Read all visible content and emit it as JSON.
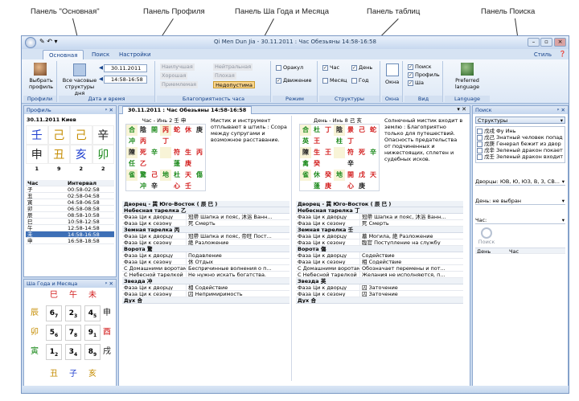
{
  "annotations": [
    "Панель \"Основная\"",
    "Панель Профиля",
    "Панель Ша Года и Месяца",
    "Панель таблиц",
    "Панель Поиска"
  ],
  "window": {
    "title": "Qi Men Dun Jia - 30.11.2011 : Час Обезьяны 14:58-16:58"
  },
  "tabs": [
    "Основная",
    "Поиск",
    "Настройки"
  ],
  "style_label": "Стиль",
  "ribbon": {
    "profiles": {
      "btn": "Выбрать профиль",
      "label": "Профили"
    },
    "datetime": {
      "all_hours": "Все часовые структуры дня",
      "date": "30.11.2011",
      "time": "14:58-16:58",
      "label": "Дата и время"
    },
    "favor": {
      "chips": [
        "Наилучшая",
        "Хорошая",
        "Приемлемая",
        "Нейтральная",
        "Плохая",
        "Недопустима"
      ],
      "label": "Благоприятность часа"
    },
    "mode": {
      "items": [
        "Оракул",
        "Движение"
      ],
      "label": "Режим"
    },
    "structures": {
      "items": [
        "Час",
        "Месяц",
        "День",
        "Год"
      ],
      "label": "Структуры"
    },
    "windows": {
      "btn": "Окна",
      "label": "Окна"
    },
    "view": {
      "items": [
        "Поиск",
        "Профиль",
        "Ша"
      ],
      "label": "Вид"
    },
    "language": {
      "btn": "Preferred language",
      "label": "Language"
    }
  },
  "profile": {
    "title": "Профиль",
    "date_city": "30.11.2011 Киев",
    "pillars_top": [
      "壬",
      "己",
      "己",
      "辛"
    ],
    "pillars_bottom": [
      "申",
      "丑",
      "亥",
      "卯"
    ],
    "numbers": [
      "1",
      "9",
      "2",
      "2"
    ],
    "cols": [
      "Час",
      "Интервал"
    ],
    "rows": [
      [
        "子",
        "00:58-02:58"
      ],
      [
        "丑",
        "02:58-04:58"
      ],
      [
        "寅",
        "04:58-06:58"
      ],
      [
        "卯",
        "06:58-08:58"
      ],
      [
        "辰",
        "08:58-10:58"
      ],
      [
        "巳",
        "10:58-12:58"
      ],
      [
        "午",
        "12:58-14:58"
      ],
      [
        "未",
        "14:58-16:58"
      ],
      [
        "申",
        "16:58-18:58"
      ]
    ]
  },
  "sha": {
    "title": "Ша Года и Месяца",
    "top": [
      "巳",
      "午",
      "未"
    ],
    "left": [
      "辰",
      "卯",
      "寅"
    ],
    "right": [
      "申",
      "酉",
      "戌"
    ],
    "bottom": [
      "丑",
      "子",
      "亥"
    ],
    "grid": [
      [
        "6",
        "7"
      ],
      [
        "2",
        "3"
      ],
      [
        "4",
        "5"
      ],
      [
        "5",
        "6"
      ],
      [
        "7",
        "8"
      ],
      [
        "9",
        "1"
      ],
      [
        "1",
        "2"
      ],
      [
        "3",
        "4"
      ],
      [
        "8",
        "9"
      ]
    ]
  },
  "doc_tab": "30.11.2011 : Час Обезьяны 14:58-16:58",
  "left_table": {
    "heading": "Час - Инь 2 壬 申",
    "text": "Мистик и инструмент отплывают в штиль : Ссора между супругами и возможное расставание.",
    "palace": "Дворец - 巽 Юго-Восток ( 辰 巳 )",
    "sections": [
      {
        "name": "Небесная тарелка  乙",
        "rows": [
          [
            "Фаза Ци к дворцу",
            "冠帶 Шапка и пояс, 沐浴 Ванн..."
          ],
          [
            "Фаза Ци к сезону",
            "死 Смерть"
          ]
        ]
      },
      {
        "name": "Земная тарелка  丙",
        "rows": [
          [
            "Фаза Ци к дворцу",
            "冠帶 Шапка и пояс, 帝旺 Пост..."
          ],
          [
            "Фаза Ци к сезону",
            "絶 Разложение"
          ]
        ]
      },
      {
        "name": "Ворота  驚",
        "rows": [
          [
            "Фаза Ци к дворцу",
            "Подавление"
          ],
          [
            "Фаза Ци к сезону",
            "休 Отдых"
          ],
          [
            "С Домашними воротами",
            "Беспричинные волнения о п..."
          ],
          [
            "С Небесной тарелкой",
            "Не нужно искать богатства."
          ]
        ]
      },
      {
        "name": "Звезда  冲",
        "rows": [
          [
            "Фаза Ци к дворцу",
            "相 Содействие"
          ],
          [
            "Фаза Ци к сезону",
            "囚 Непримиримость"
          ]
        ]
      },
      {
        "name": "Дух  合",
        "rows": []
      }
    ]
  },
  "right_table": {
    "heading": "День - Инь 8 己 亥",
    "text": "Солнечный мистик входит в землю : Благоприятно только для путешествий. Опасность предательства от подчиненных и нижестоящих, сплетен и судебных исков.",
    "palace": "Дворец - 巽 Юго-Восток ( 辰 巳 )",
    "sections": [
      {
        "name": "Небесная тарелка  丁",
        "rows": [
          [
            "Фаза Ци к дворцу",
            "冠帶 Шапка и пояс, 沐浴 Ванн..."
          ],
          [
            "Фаза Ци к сезону",
            "死 Смерть"
          ]
        ]
      },
      {
        "name": "Земная тарелка  壬",
        "rows": [
          [
            "Фаза Ци к дворцу",
            "墓 Могила, 絶 Разложение"
          ],
          [
            "Фаза Ци к сезону",
            "臨官 Поступление на службу"
          ]
        ]
      },
      {
        "name": "Ворота  傷",
        "rows": [
          [
            "Фаза Ци к дворцу",
            "Содействие"
          ],
          [
            "Фаза Ци к сезону",
            "相 Содействие"
          ],
          [
            "С Домашними воротами",
            "Обозначает перемены и пот..."
          ],
          [
            "С Небесной тарелкой",
            "Желания не исполняются, п..."
          ]
        ]
      },
      {
        "name": "Звезда  英",
        "rows": [
          [
            "Фаза Ци к дворцу",
            "囚 Заточение"
          ],
          [
            "Фаза Ци к сезону",
            "囚 Заточение"
          ]
        ]
      },
      {
        "name": "Дух  合",
        "rows": []
      }
    ]
  },
  "left_chart": [
    [
      [
        "合",
        "g"
      ],
      [
        "陰",
        "k"
      ],
      [
        "開",
        "g"
      ],
      [
        "丙",
        "r"
      ],
      [
        "蛇",
        "r"
      ],
      [
        "休",
        "r"
      ],
      [
        "庚",
        "k"
      ]
    ],
    [
      [
        "冲",
        "g"
      ],
      [
        "丙",
        "r"
      ],
      [
        "",
        "k"
      ],
      [
        "丁",
        "r"
      ],
      [
        "",
        "k"
      ],
      [
        "",
        "k"
      ],
      [
        "",
        "k"
      ]
    ],
    [
      [
        "陳",
        "k"
      ],
      [
        "死",
        "r"
      ],
      [
        "辛",
        "g"
      ],
      [
        "",
        "k"
      ],
      [
        "符",
        "r"
      ],
      [
        "生",
        "r"
      ],
      [
        "丙",
        "r"
      ]
    ],
    [
      [
        "任",
        "g"
      ],
      [
        "乙",
        "r"
      ],
      [
        "",
        "k"
      ],
      [
        "",
        "k"
      ],
      [
        "蓬",
        "g"
      ],
      [
        "庚",
        "r"
      ],
      [
        "",
        "k"
      ]
    ],
    [
      [
        "雀",
        "g"
      ],
      [
        "驚",
        "g"
      ],
      [
        "己",
        "r"
      ],
      [
        "地",
        "g"
      ],
      [
        "杜",
        "g"
      ],
      [
        "天",
        "r"
      ],
      [
        "傷",
        "g"
      ]
    ],
    [
      [
        "",
        "k"
      ],
      [
        "冲",
        "g"
      ],
      [
        "辛",
        "k"
      ],
      [
        "",
        "k"
      ],
      [
        "心",
        "r"
      ],
      [
        "壬",
        "r"
      ],
      [
        "",
        "k"
      ]
    ]
  ],
  "right_chart": [
    [
      [
        "合",
        "g"
      ],
      [
        "杜",
        "g"
      ],
      [
        "丁",
        "r"
      ],
      [
        "陰",
        "k"
      ],
      [
        "景",
        "r"
      ],
      [
        "己",
        "r"
      ],
      [
        "蛇",
        "r"
      ]
    ],
    [
      [
        "英",
        "g"
      ],
      [
        "王",
        "r"
      ],
      [
        "",
        "k"
      ],
      [
        "柱",
        "g"
      ],
      [
        "丁",
        "r"
      ],
      [
        "",
        "k"
      ],
      [
        "",
        "k"
      ]
    ],
    [
      [
        "陳",
        "k"
      ],
      [
        "生",
        "r"
      ],
      [
        "王",
        "r"
      ],
      [
        "",
        "k"
      ],
      [
        "符",
        "r"
      ],
      [
        "死",
        "r"
      ],
      [
        "辛",
        "g"
      ]
    ],
    [
      [
        "禽",
        "g"
      ],
      [
        "癸",
        "r"
      ],
      [
        "",
        "k"
      ],
      [
        "",
        "k"
      ],
      [
        "辛",
        "k"
      ],
      [
        "",
        "k"
      ],
      [
        "",
        "k"
      ]
    ],
    [
      [
        "雀",
        "g"
      ],
      [
        "休",
        "g"
      ],
      [
        "癸",
        "r"
      ],
      [
        "地",
        "g"
      ],
      [
        "開",
        "r"
      ],
      [
        "戊",
        "r"
      ],
      [
        "天",
        "r"
      ]
    ],
    [
      [
        "",
        "k"
      ],
      [
        "蓬",
        "g"
      ],
      [
        "庚",
        "r"
      ],
      [
        "",
        "k"
      ],
      [
        "心",
        "r"
      ],
      [
        "庚",
        "k"
      ],
      [
        "",
        "k"
      ]
    ]
  ],
  "search": {
    "title": "Поиск",
    "structures_label": "Структуры",
    "list": [
      "戊戌 Фу Инь",
      "戊己 Знатный человек попад",
      "戊庚 Генерал бежит из двор",
      "戊辛 Зеленый дракон покает",
      "戊壬 Зеленый дракон входит"
    ],
    "palaces": "Дворцы: ЮВ, Ю, ЮЗ, В, З, СВ...",
    "day": "День: не выбран",
    "hour": "Час:",
    "search_btn": "Поиск",
    "col_day": "День",
    "col_hour": "Час"
  }
}
